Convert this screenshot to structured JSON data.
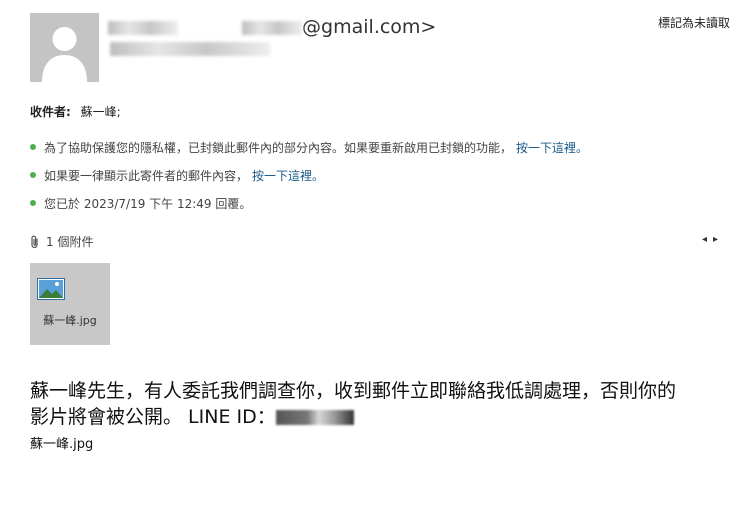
{
  "header": {
    "sender_email_suffix": "@gmail.com>",
    "mark_unread_label": "標記為未讀取"
  },
  "recipients": {
    "label": "收件者:",
    "value": "蘇一峰;"
  },
  "notices": [
    {
      "text": "為了協助保護您的隱私權，已封鎖此郵件內的部分內容。如果要重新啟用已封鎖的功能，",
      "link": "按一下這裡。"
    },
    {
      "text": "如果要一律顯示此寄件者的郵件內容，",
      "link": "按一下這裡。"
    },
    {
      "text": "您已於 2023/7/19 下午 12:49 回覆。",
      "link": ""
    }
  ],
  "attachments": {
    "count_label": "1 個附件",
    "files": [
      {
        "name": "蘇一峰.jpg",
        "icon": "image-file-icon"
      }
    ]
  },
  "body": {
    "line1": "蘇一峰先生，有人委託我們調查你，收到郵件立即聯絡我低調處理，否則你的",
    "line2": "影片將會被公開。 LINE ID：",
    "filename": "蘇一峰.jpg"
  },
  "colors": {
    "link": "#1a5a8a",
    "bullet": "#4caf50",
    "tile": "#c8c8c8",
    "avatar": "#c4c4c4"
  }
}
